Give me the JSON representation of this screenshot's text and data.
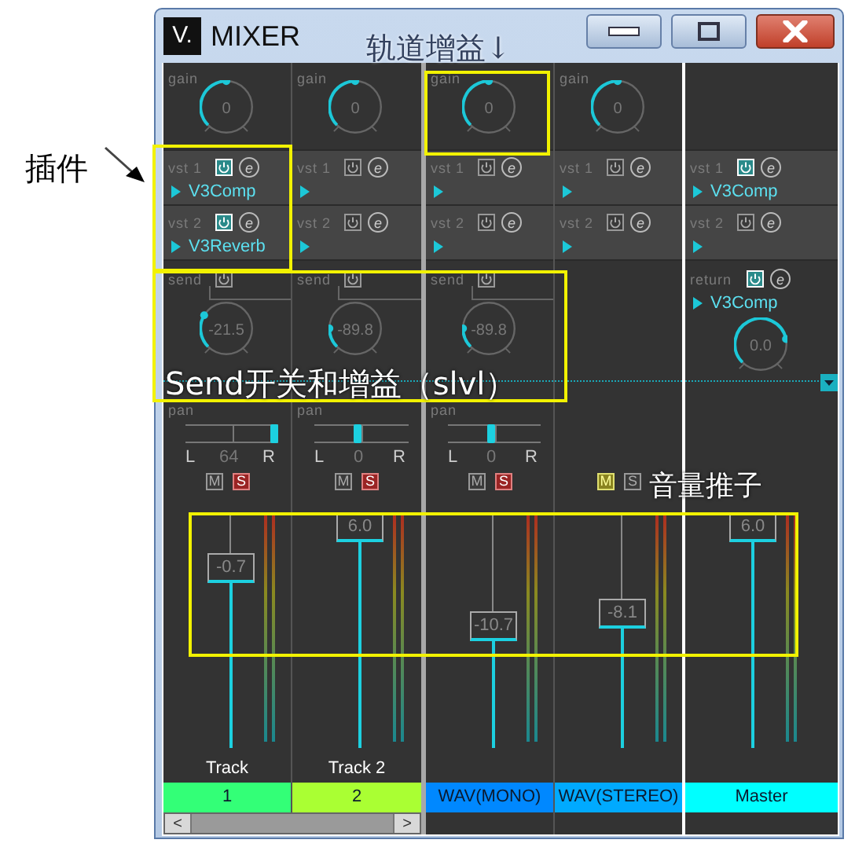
{
  "window": {
    "logo": "V.",
    "title": "MIXER"
  },
  "strips": [
    {
      "kind": "track",
      "gain": {
        "label": "gain",
        "value": "0",
        "level": 0.5
      },
      "inserts": [
        {
          "label": "vst 1",
          "on": true,
          "edit": "e",
          "plugin": "V3Comp"
        },
        {
          "label": "vst 2",
          "on": true,
          "edit": "e",
          "plugin": "V3Reverb"
        }
      ],
      "send": {
        "label": "send",
        "on": false,
        "value": "-21.5",
        "level": 0.07
      },
      "pan": {
        "label": "pan",
        "left": "L",
        "value": "64",
        "right": "R",
        "level": 1
      },
      "mute": {
        "label": "M",
        "on": false
      },
      "solo": {
        "label": "S",
        "on": true
      },
      "fader": {
        "value": "-0.7",
        "level": 0.8
      },
      "name": "Track",
      "tag": "1",
      "color": "#33ff77"
    },
    {
      "kind": "track",
      "gain": {
        "label": "gain",
        "value": "0",
        "level": 0.5
      },
      "inserts": [
        {
          "label": "vst 1",
          "on": false,
          "edit": "e"
        },
        {
          "label": "vst 2",
          "on": false,
          "edit": "e"
        }
      ],
      "send": {
        "label": "send",
        "on": false,
        "value": "-89.8",
        "level": 0
      },
      "pan": {
        "label": "pan",
        "left": "L",
        "value": "0",
        "right": "R",
        "level": 0.5
      },
      "mute": {
        "label": "M",
        "on": false
      },
      "solo": {
        "label": "S",
        "on": true
      },
      "fader": {
        "value": "6.0",
        "level": 1
      },
      "name": "Track 2",
      "tag": "2",
      "color": "#aaff33"
    },
    {
      "kind": "track",
      "gain": {
        "label": "gain",
        "value": "0",
        "level": 0.5
      },
      "inserts": [
        {
          "label": "vst 1",
          "on": false,
          "edit": "e"
        },
        {
          "label": "vst 2",
          "on": false,
          "edit": "e"
        }
      ],
      "send": {
        "label": "send",
        "on": false,
        "value": "-89.8",
        "level": 0
      },
      "pan": {
        "label": "pan",
        "left": "L",
        "value": "0",
        "right": "R",
        "level": 0.5
      },
      "mute": {
        "label": "M",
        "on": false
      },
      "solo": {
        "label": "S",
        "on": true
      },
      "fader": {
        "value": "-10.7",
        "level": 0.52
      },
      "tag": "WAV(MONO)",
      "color": "#0088ff"
    },
    {
      "kind": "track",
      "gain": {
        "label": "gain",
        "value": "0",
        "level": 0.5
      },
      "inserts": [
        {
          "label": "vst 1",
          "on": false,
          "edit": "e"
        },
        {
          "label": "vst 2",
          "on": false,
          "edit": "e"
        }
      ],
      "mute": {
        "label": "M",
        "on": true
      },
      "solo": {
        "label": "S",
        "on": false
      },
      "fader": {
        "value": "-8.1",
        "level": 0.58
      },
      "tag": "WAV(STEREO)",
      "color": "#00aaff"
    },
    {
      "kind": "master",
      "inserts": [
        {
          "label": "vst 1",
          "on": true,
          "edit": "e",
          "plugin": "V3Comp"
        },
        {
          "label": "vst 2",
          "on": false,
          "edit": "e"
        }
      ],
      "return": {
        "label": "return",
        "on": true,
        "edit": "e",
        "plugin": "V3Comp",
        "value": "0.0",
        "level": 0.99
      },
      "fader": {
        "value": "6.0",
        "level": 1
      },
      "tag": "Master",
      "color": "#00ffff"
    }
  ],
  "scrollbar": {
    "left": "<",
    "right": ">"
  },
  "annotations": [
    {
      "kind": "plugin",
      "text": "插件"
    },
    {
      "kind": "gain",
      "text": "轨道增益↓"
    },
    {
      "kind": "send",
      "text": "Send开关和增益（slvl）"
    },
    {
      "kind": "fader",
      "text": "音量推子"
    }
  ]
}
